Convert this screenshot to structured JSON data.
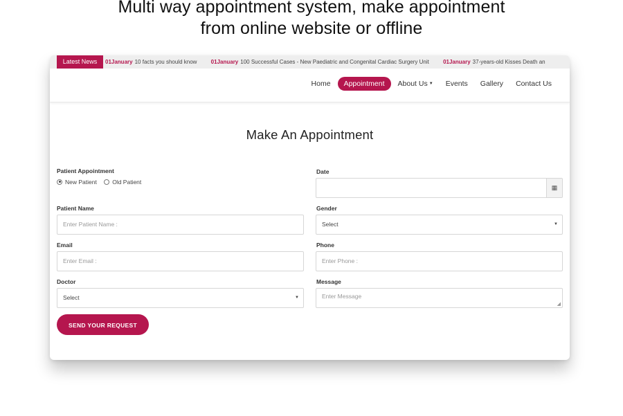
{
  "headline": {
    "line1": "Multi way appointment system, make appointment",
    "line2": "from online website or offline"
  },
  "ticker": {
    "badge": "Latest News",
    "items": [
      {
        "date": "01January",
        "text": "10 facts you should know"
      },
      {
        "date": "01January",
        "text": "100 Successful Cases - New Paediatric and Congenital Cardiac Surgery Unit"
      },
      {
        "date": "01January",
        "text": "37-years-old Kisses Death an"
      }
    ]
  },
  "nav": {
    "home": "Home",
    "appointment": "Appointment",
    "about": "About Us",
    "events": "Events",
    "gallery": "Gallery",
    "contact": "Contact Us"
  },
  "form": {
    "title": "Make An Appointment",
    "patient_appointment_label": "Patient Appointment",
    "new_patient": "New Patient",
    "old_patient": "Old Patient",
    "date_label": "Date",
    "patient_name_label": "Patient Name",
    "patient_name_placeholder": "Enter Patient Name :",
    "gender_label": "Gender",
    "gender_value": "Select",
    "email_label": "Email",
    "email_placeholder": "Enter Email :",
    "phone_label": "Phone",
    "phone_placeholder": "Enter Phone :",
    "doctor_label": "Doctor",
    "doctor_value": "Select",
    "message_label": "Message",
    "message_placeholder": "Enter Message",
    "submit": "SEND YOUR REQUEST"
  },
  "colors": {
    "accent": "#b5164e",
    "ticker_bg": "#eeeeee"
  },
  "icons": {
    "calendar": "calendar-icon",
    "dropdown": "chevron-down-icon"
  }
}
